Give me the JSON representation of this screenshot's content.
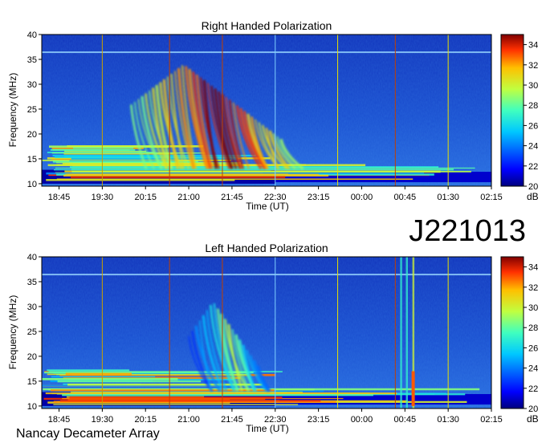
{
  "identifier": "J221013",
  "footer": "Nancay Decameter Array",
  "colorbar": {
    "unit": "dB",
    "ticks": [
      20,
      22,
      24,
      26,
      28,
      30,
      32,
      34
    ],
    "range": [
      20,
      35
    ],
    "colors": [
      "#00007f",
      "#0000ff",
      "#007fff",
      "#00ffff",
      "#7fff7f",
      "#ffff00",
      "#ff7f00",
      "#ff0000",
      "#7f0000"
    ]
  },
  "chart_data": [
    {
      "type": "heatmap",
      "title": "Right Handed Polarization",
      "xlabel": "Time (UT)",
      "ylabel": "Frequency (MHz)",
      "xticks": [
        "18:45",
        "19:30",
        "20:15",
        "21:00",
        "21:45",
        "22:30",
        "23:15",
        "00:00",
        "00:45",
        "01:30",
        "02:15"
      ],
      "yticks": [
        10,
        15,
        20,
        25,
        30,
        35,
        40
      ],
      "ylim": [
        9.5,
        40
      ],
      "features": [
        {
          "name": "main emission arc",
          "time_range": [
            "20:00",
            "23:15"
          ],
          "freq_range": [
            13,
            34
          ],
          "peak_dB": 34
        },
        {
          "name": "low-frequency band",
          "time_range": [
            "18:30",
            "02:15"
          ],
          "freq_range": [
            10,
            18
          ],
          "peak_dB": 33
        }
      ]
    },
    {
      "type": "heatmap",
      "title": "Left Handed Polarization",
      "xlabel": "Time (UT)",
      "ylabel": "Frequency (MHz)",
      "xticks": [
        "18:45",
        "19:30",
        "20:15",
        "21:00",
        "21:45",
        "22:30",
        "23:15",
        "00:00",
        "00:45",
        "01:30",
        "02:15"
      ],
      "yticks": [
        10,
        15,
        20,
        25,
        30,
        35,
        40
      ],
      "ylim": [
        9.5,
        40
      ],
      "features": [
        {
          "name": "weak emission arc",
          "time_range": [
            "21:00",
            "22:30"
          ],
          "freq_range": [
            13,
            31
          ],
          "peak_dB": 28
        },
        {
          "name": "interference streaks",
          "time_range": [
            "00:40",
            "00:55"
          ],
          "freq_range": [
            10,
            40
          ],
          "peak_dB": 34
        },
        {
          "name": "low-frequency band",
          "time_range": [
            "18:30",
            "02:15"
          ],
          "freq_range": [
            10,
            18
          ],
          "peak_dB": 33
        }
      ]
    }
  ]
}
